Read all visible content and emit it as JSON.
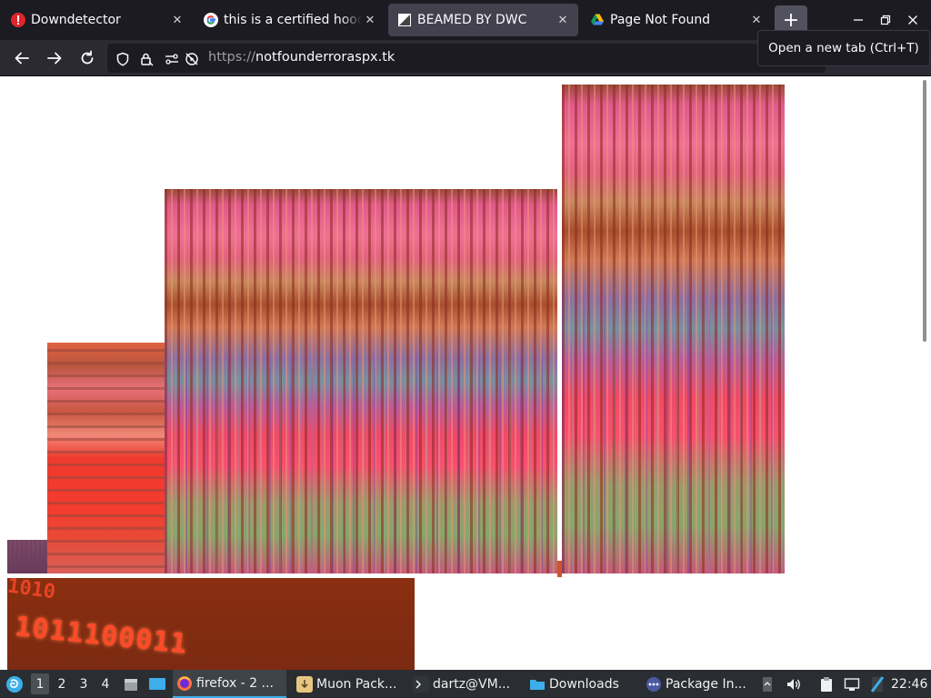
{
  "browser": {
    "tabs": [
      {
        "title": "Downdetector",
        "favicon": "downdetector-icon",
        "active": false
      },
      {
        "title": "this is a certified hood",
        "favicon": "google-icon",
        "active": false
      },
      {
        "title": "BEAMED BY DWC",
        "favicon": "page-image-icon",
        "active": true
      },
      {
        "title": "Page Not Found",
        "favicon": "google-drive-icon",
        "active": false
      }
    ],
    "new_tab_symbol": "+",
    "tooltip": "Open a new tab (Ctrl+T)",
    "url": {
      "scheme": "https://",
      "host": "notfounderroraspx.tk"
    }
  },
  "page": {
    "binary_text_top": "1010",
    "binary_text": "1011100011"
  },
  "taskbar": {
    "workspaces": [
      "1",
      "2",
      "3",
      "4"
    ],
    "current_workspace": "1",
    "windows": [
      {
        "label": "firefox - 2 ...",
        "icon": "firefox-icon",
        "active": true
      },
      {
        "label": "Muon Pack...",
        "icon": "package-icon",
        "active": false
      },
      {
        "label": "dartz@VM...",
        "icon": "terminal-icon",
        "active": false
      },
      {
        "label": "Downloads",
        "icon": "folder-icon",
        "active": false
      },
      {
        "label": "Package In...",
        "icon": "package-info-icon",
        "active": false
      }
    ],
    "clock": "22:46"
  },
  "colors": {
    "tab_strip": "#1c1b22",
    "nav_bar": "#2b2a33",
    "active_tab": "#42414d",
    "taskbar": "#2a2e32",
    "accent": "#3daee9"
  }
}
